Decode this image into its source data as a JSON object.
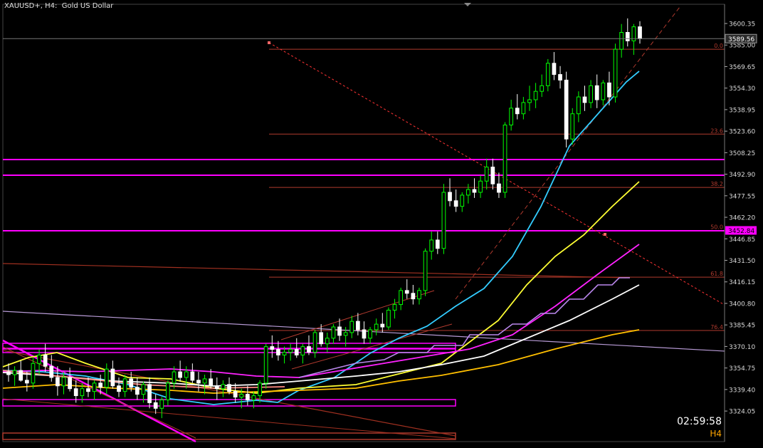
{
  "header": {
    "symbol": "XAUUSD+",
    "timeframe": "H4",
    "description": "Gold US Dollar"
  },
  "timer": {
    "countdown": "02:59:58",
    "timeframe_label": "H4"
  },
  "colors": {
    "background": "#000000",
    "bull_candle": "#00ff00",
    "bear_candle": "#ffffff",
    "ma_cyan": "#33ccff",
    "ma_yellow": "#ffff33",
    "ma_magenta": "#ff22ff",
    "ma_white": "#ffffff",
    "ma_orange": "#ffbf00",
    "ma_lavender": "#bb88ee",
    "fib": "#b03a2e",
    "zone": "#ff00ff",
    "trend": "#a03020",
    "axis_text": "#d8d8d8"
  },
  "chart_data": {
    "type": "candlestick",
    "title": "XAUUSD+, H4:  Gold US Dollar",
    "ylim": [
      3317,
      3610
    ],
    "y_ticks": [
      "3600.35",
      "3585.00",
      "3569.65",
      "3554.30",
      "3538.95",
      "3523.60",
      "3508.25",
      "3492.90",
      "3477.55",
      "3462.20",
      "3446.85",
      "3431.50",
      "3416.15",
      "3400.80",
      "3385.45",
      "3370.10",
      "3354.75",
      "3339.40",
      "3324.05"
    ],
    "current_price": "3589.56",
    "zone_price_label": "3452.84",
    "fib_levels": [
      {
        "label": "0.0",
        "price": 3582.0
      },
      {
        "label": "23.6",
        "price": 3521.5
      },
      {
        "label": "38.2",
        "price": 3483.5
      },
      {
        "label": "50.0",
        "price": 3452.8
      },
      {
        "label": "61.8",
        "price": 3419.5
      },
      {
        "label": "76.4",
        "price": 3381.5
      }
    ],
    "candles": [
      [
        3352,
        3358,
        3345,
        3350
      ],
      [
        3350,
        3356,
        3342,
        3353
      ],
      [
        3353,
        3360,
        3345,
        3346
      ],
      [
        3346,
        3352,
        3338,
        3344
      ],
      [
        3344,
        3362,
        3340,
        3358
      ],
      [
        3358,
        3368,
        3350,
        3364
      ],
      [
        3364,
        3372,
        3352,
        3356
      ],
      [
        3356,
        3364,
        3345,
        3348
      ],
      [
        3348,
        3356,
        3335,
        3342
      ],
      [
        3342,
        3352,
        3336,
        3348
      ],
      [
        3348,
        3355,
        3338,
        3340
      ],
      [
        3340,
        3346,
        3330,
        3335
      ],
      [
        3335,
        3344,
        3330,
        3340
      ],
      [
        3340,
        3348,
        3334,
        3338
      ],
      [
        3338,
        3346,
        3332,
        3344
      ],
      [
        3344,
        3350,
        3336,
        3341
      ],
      [
        3341,
        3358,
        3336,
        3354
      ],
      [
        3354,
        3360,
        3340,
        3342
      ],
      [
        3342,
        3348,
        3334,
        3338
      ],
      [
        3338,
        3350,
        3334,
        3347
      ],
      [
        3347,
        3352,
        3338,
        3341
      ],
      [
        3341,
        3348,
        3332,
        3336
      ],
      [
        3336,
        3345,
        3330,
        3343
      ],
      [
        3343,
        3348,
        3326,
        3330
      ],
      [
        3330,
        3336,
        3322,
        3326
      ],
      [
        3326,
        3334,
        3319,
        3332
      ],
      [
        3332,
        3346,
        3328,
        3344
      ],
      [
        3344,
        3356,
        3340,
        3352
      ],
      [
        3352,
        3360,
        3345,
        3348
      ],
      [
        3348,
        3356,
        3340,
        3352
      ],
      [
        3352,
        3358,
        3344,
        3346
      ],
      [
        3346,
        3352,
        3338,
        3344
      ],
      [
        3344,
        3350,
        3336,
        3347
      ],
      [
        3347,
        3354,
        3340,
        3342
      ],
      [
        3342,
        3348,
        3332,
        3340
      ],
      [
        3340,
        3346,
        3334,
        3343
      ],
      [
        3343,
        3348,
        3336,
        3338
      ],
      [
        3338,
        3344,
        3330,
        3334
      ],
      [
        3334,
        3340,
        3326,
        3336
      ],
      [
        3336,
        3342,
        3328,
        3332
      ],
      [
        3332,
        3338,
        3326,
        3335
      ],
      [
        3335,
        3346,
        3330,
        3344
      ],
      [
        3344,
        3372,
        3340,
        3370
      ],
      [
        3370,
        3378,
        3362,
        3368
      ],
      [
        3368,
        3374,
        3360,
        3364
      ],
      [
        3364,
        3370,
        3358,
        3366
      ],
      [
        3366,
        3372,
        3360,
        3368
      ],
      [
        3368,
        3376,
        3362,
        3364
      ],
      [
        3364,
        3372,
        3358,
        3370
      ],
      [
        3370,
        3378,
        3364,
        3366
      ],
      [
        3366,
        3382,
        3362,
        3380
      ],
      [
        3380,
        3386,
        3370,
        3372
      ],
      [
        3372,
        3380,
        3366,
        3376
      ],
      [
        3376,
        3386,
        3372,
        3384
      ],
      [
        3384,
        3390,
        3374,
        3378
      ],
      [
        3378,
        3384,
        3370,
        3380
      ],
      [
        3380,
        3392,
        3376,
        3388
      ],
      [
        3388,
        3394,
        3378,
        3382
      ],
      [
        3382,
        3388,
        3372,
        3376
      ],
      [
        3376,
        3384,
        3372,
        3382
      ],
      [
        3382,
        3390,
        3378,
        3386
      ],
      [
        3386,
        3394,
        3380,
        3384
      ],
      [
        3384,
        3398,
        3382,
        3396
      ],
      [
        3396,
        3404,
        3390,
        3400
      ],
      [
        3400,
        3412,
        3396,
        3410
      ],
      [
        3410,
        3418,
        3404,
        3408
      ],
      [
        3408,
        3414,
        3400,
        3404
      ],
      [
        3404,
        3412,
        3400,
        3410
      ],
      [
        3410,
        3440,
        3406,
        3438
      ],
      [
        3438,
        3452,
        3432,
        3446
      ],
      [
        3446,
        3452,
        3436,
        3440
      ],
      [
        3440,
        3486,
        3436,
        3480
      ],
      [
        3480,
        3490,
        3470,
        3474
      ],
      [
        3474,
        3482,
        3466,
        3470
      ],
      [
        3470,
        3480,
        3466,
        3478
      ],
      [
        3478,
        3486,
        3472,
        3482
      ],
      [
        3482,
        3490,
        3476,
        3480
      ],
      [
        3480,
        3492,
        3476,
        3488
      ],
      [
        3488,
        3504,
        3482,
        3498
      ],
      [
        3498,
        3504,
        3482,
        3486
      ],
      [
        3486,
        3494,
        3476,
        3480
      ],
      [
        3480,
        3530,
        3476,
        3528
      ],
      [
        3528,
        3546,
        3524,
        3540
      ],
      [
        3540,
        3550,
        3532,
        3536
      ],
      [
        3536,
        3548,
        3532,
        3544
      ],
      [
        3544,
        3556,
        3538,
        3546
      ],
      [
        3546,
        3558,
        3540,
        3552
      ],
      [
        3552,
        3564,
        3548,
        3556
      ],
      [
        3556,
        3575,
        3552,
        3572
      ],
      [
        3572,
        3580,
        3560,
        3564
      ],
      [
        3564,
        3570,
        3554,
        3560
      ],
      [
        3560,
        3566,
        3512,
        3518
      ],
      [
        3518,
        3540,
        3514,
        3536
      ],
      [
        3536,
        3552,
        3530,
        3548
      ],
      [
        3548,
        3556,
        3538,
        3544
      ],
      [
        3544,
        3560,
        3540,
        3556
      ],
      [
        3556,
        3564,
        3540,
        3546
      ],
      [
        3546,
        3560,
        3542,
        3558
      ],
      [
        3558,
        3566,
        3542,
        3548
      ],
      [
        3548,
        3586,
        3544,
        3582
      ],
      [
        3582,
        3600,
        3576,
        3594
      ],
      [
        3594,
        3604,
        3584,
        3588
      ],
      [
        3588,
        3600,
        3578,
        3598
      ],
      [
        3598,
        3602,
        3586,
        3589.56
      ]
    ]
  }
}
